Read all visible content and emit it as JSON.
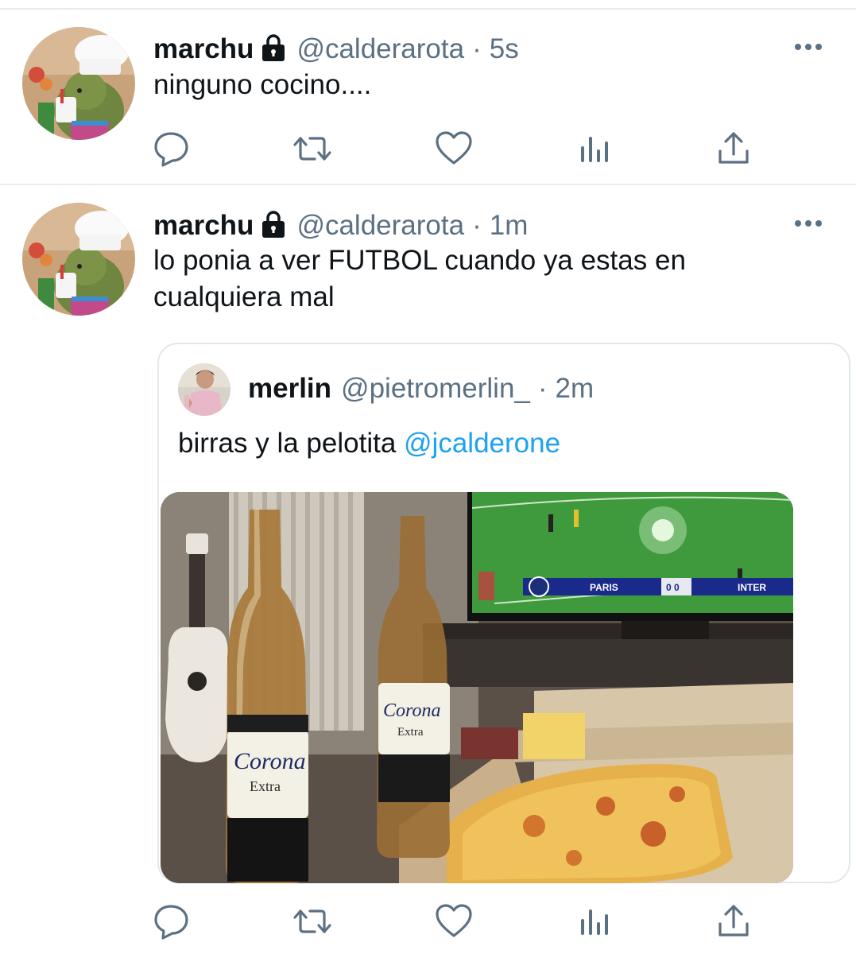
{
  "tweets": [
    {
      "name": "marchu",
      "handle": "@calderarota",
      "separator": "·",
      "time": "5s",
      "text": "ninguno cocino...."
    },
    {
      "name": "marchu",
      "handle": "@calderarota",
      "separator": "·",
      "time": "1m",
      "text": "lo ponia a ver FUTBOL cuando ya estas en cualquiera mal",
      "quote": {
        "name": "merlin",
        "handle": "@pietromerlin_",
        "separator": "·",
        "time": "2m",
        "text": "birras y la pelotita",
        "mention": "@jcalderone",
        "photo": {
          "tv_home": "PARIS",
          "tv_score": "0 0",
          "tv_away": "INTER",
          "bottle_brand": "Corona",
          "bottle_sub": "Extra"
        }
      }
    }
  ],
  "icons": {
    "reply": "reply-icon",
    "retweet": "retweet-icon",
    "like": "heart-icon",
    "analytics": "analytics-icon",
    "share": "share-icon",
    "more": "more-icon",
    "lock": "lock-icon"
  },
  "colors": {
    "text": "#0f1419",
    "muted": "#5b7083",
    "link": "#1da1f2",
    "divider": "#e6ecf0"
  }
}
